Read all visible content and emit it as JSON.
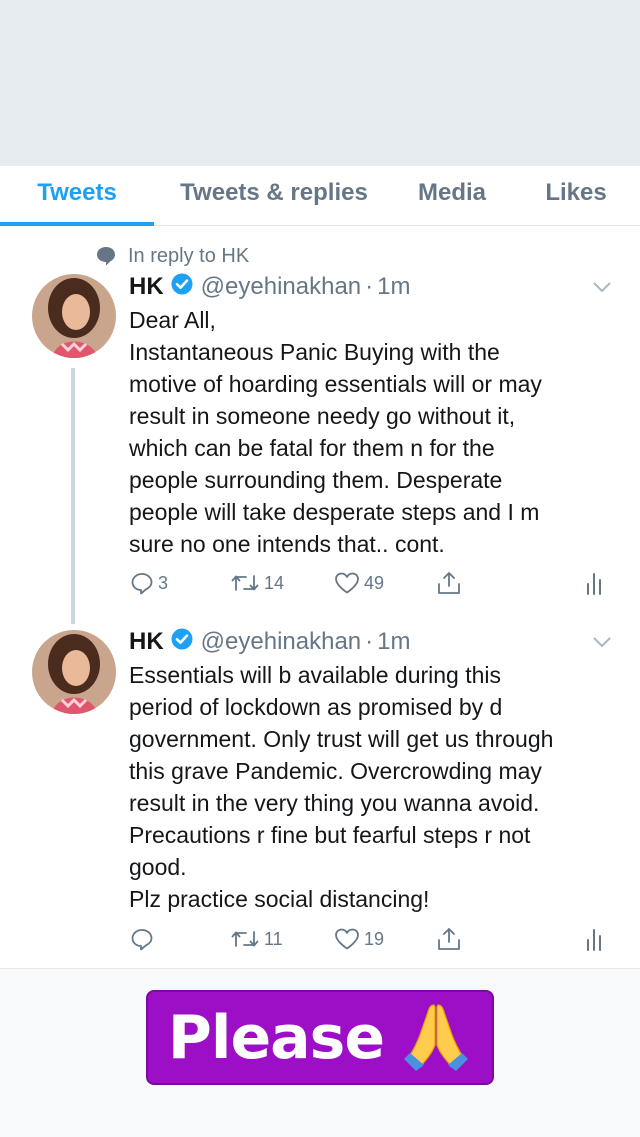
{
  "tabs": [
    {
      "label": "Tweets",
      "active": true
    },
    {
      "label": "Tweets & replies",
      "active": false
    },
    {
      "label": "Media",
      "active": false
    },
    {
      "label": "Likes",
      "active": false
    }
  ],
  "tweets": [
    {
      "reply_context": "In reply to HK",
      "name": "HK",
      "verified": true,
      "handle": "@eyehinakhan",
      "separator": "·",
      "time": "1m",
      "lines": [
        "Dear All,",
        "Instantaneous Panic Buying with the",
        "motive of hoarding essentials will or may",
        "result in someone needy go without it,",
        "which can be fatal for them n for the",
        "people surrounding them. Desperate",
        "people will take desperate steps and I m",
        "sure no one intends that.. cont."
      ],
      "replies": "3",
      "retweets": "14",
      "likes": "49"
    },
    {
      "name": "HK",
      "verified": true,
      "handle": "@eyehinakhan",
      "separator": "·",
      "time": "1m",
      "lines": [
        "Essentials will b available during this",
        "period of lockdown as promised by d",
        "government. Only trust will get us through",
        "this grave Pandemic. Overcrowding may",
        "result in the very thing you wanna avoid.",
        "Precautions r fine but fearful steps r not",
        "good.",
        "Plz practice social distancing!"
      ],
      "replies": "",
      "retweets": "11",
      "likes": "19"
    }
  ],
  "banner": {
    "text": "Please",
    "emoji": "🙏",
    "background": "#9c0fc7"
  },
  "colors": {
    "accent": "#1da1f2",
    "secondary_text": "#657786",
    "primary_text": "#14171a"
  }
}
